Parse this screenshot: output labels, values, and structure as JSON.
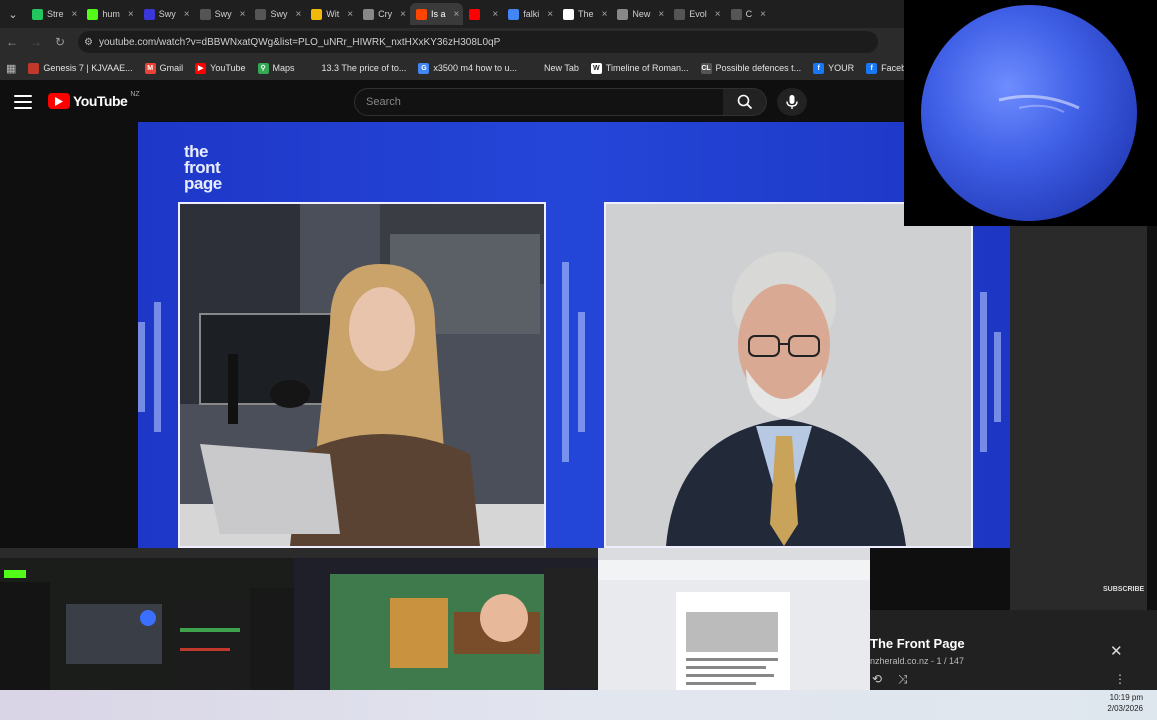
{
  "browser": {
    "tabs": [
      {
        "title": "Stre",
        "color": "#22c55e"
      },
      {
        "title": "hum",
        "color": "#53fc18"
      },
      {
        "title": "Swy",
        "color": "#3b36d9"
      },
      {
        "title": "Swy",
        "color": ""
      },
      {
        "title": "Swy",
        "color": ""
      },
      {
        "title": "Wit",
        "color": "#f0b90b"
      },
      {
        "title": "Cry",
        "color": "#888888"
      },
      {
        "title": "Is a",
        "color": "#ff4500",
        "active": true
      },
      {
        "title": "",
        "color": "#ff0000"
      },
      {
        "title": "falki",
        "color": "#4285f4"
      },
      {
        "title": "The",
        "color": "#ffffff"
      },
      {
        "title": "New",
        "color": "#888888"
      },
      {
        "title": "Evol",
        "color": ""
      },
      {
        "title": "C",
        "color": ""
      }
    ],
    "url": "youtube.com/watch?v=dBBWNxatQWg&list=PLO_uNRr_HIWRK_nxtHXxKY36zH308L0qP",
    "bookmarks": [
      {
        "label": "Genesis 7 | KJVAAE...",
        "color": "#c0392b",
        "glyph": ""
      },
      {
        "label": "Gmail",
        "color": "#ea4335",
        "glyph": "M"
      },
      {
        "label": "YouTube",
        "color": "#ff0000",
        "glyph": "▶"
      },
      {
        "label": "Maps",
        "color": "#34a853",
        "glyph": "⚲"
      },
      {
        "label": "13.3 The price of to...",
        "color": "",
        "glyph": ""
      },
      {
        "label": "x3500 m4 how to u...",
        "color": "#4285f4",
        "glyph": "G"
      },
      {
        "label": "New Tab",
        "color": "",
        "glyph": ""
      },
      {
        "label": "Timeline of Roman...",
        "color": "#ffffff",
        "glyph": "W"
      },
      {
        "label": "Possible defences t...",
        "color": "#555555",
        "glyph": "CL"
      },
      {
        "label": "YOUR",
        "color": "#1877f2",
        "glyph": "f"
      },
      {
        "label": "Facebook green",
        "color": "#1877f2",
        "glyph": "f"
      }
    ]
  },
  "youtube": {
    "logo_text": "YouTube",
    "region": "NZ",
    "search_placeholder": "Search"
  },
  "video": {
    "brand_line1": "the",
    "brand_line2": "front",
    "brand_line3": "page"
  },
  "side": {
    "subscribe_label": "SUBSCRIBE"
  },
  "playlist": {
    "title": "The Front Page",
    "subtitle": "nzherald.co.nz - 1 / 147"
  },
  "taskbar": {
    "time": "10:19 pm",
    "date": "2/03/2026"
  },
  "colors": {
    "accent": "#ff0000",
    "video_bg": "#2446d8"
  }
}
